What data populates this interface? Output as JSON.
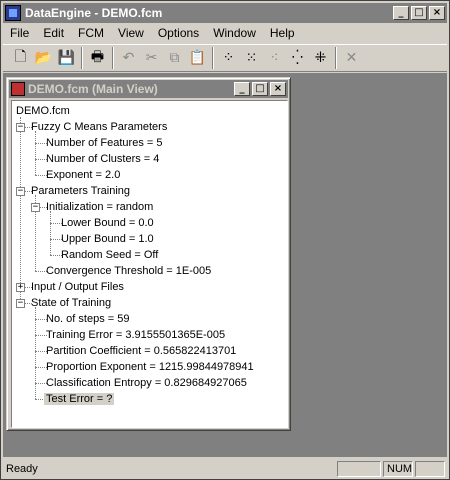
{
  "window": {
    "title": "DataEngine - DEMO.fcm"
  },
  "menu": [
    "File",
    "Edit",
    "FCM",
    "View",
    "Options",
    "Window",
    "Help"
  ],
  "toolbar": {
    "buttons": [
      {
        "name": "new-file-icon",
        "glyph": "🗋",
        "disabled": false
      },
      {
        "name": "open-folder-icon",
        "glyph": "📂",
        "disabled": false
      },
      {
        "name": "save-icon",
        "glyph": "💾",
        "disabled": false
      },
      {
        "name": "print-icon",
        "glyph": "🖶",
        "disabled": false
      },
      {
        "name": "undo-icon",
        "glyph": "↶",
        "disabled": true
      },
      {
        "name": "cut-icon",
        "glyph": "✂",
        "disabled": true
      },
      {
        "name": "copy-icon",
        "glyph": "⧉",
        "disabled": true
      },
      {
        "name": "paste-icon",
        "glyph": "📋",
        "disabled": true
      },
      {
        "name": "fcm-scatter-1-icon",
        "glyph": "⁘",
        "disabled": false
      },
      {
        "name": "fcm-scatter-2-icon",
        "glyph": "⁙",
        "disabled": false
      },
      {
        "name": "fcm-scatter-3-icon",
        "glyph": "⁖",
        "disabled": true
      },
      {
        "name": "fcm-scatter-4-icon",
        "glyph": "⁛",
        "disabled": false
      },
      {
        "name": "fcm-scatter-5-icon",
        "glyph": "⁜",
        "disabled": false
      },
      {
        "name": "delete-icon",
        "glyph": "✕",
        "disabled": true
      }
    ]
  },
  "child_window": {
    "title": "DEMO.fcm (Main View)"
  },
  "tree": [
    {
      "level": 0,
      "label": "DEMO.fcm",
      "expander": null
    },
    {
      "level": 1,
      "label": "Fuzzy C Means Parameters",
      "expander": "-"
    },
    {
      "level": 2,
      "label": "Number of Features = 5",
      "expander": null
    },
    {
      "level": 2,
      "label": "Number of Clusters = 4",
      "expander": null
    },
    {
      "level": 2,
      "label": "Exponent = 2.0",
      "expander": null
    },
    {
      "level": 1,
      "label": "Parameters Training",
      "expander": "-"
    },
    {
      "level": 2,
      "label": "Initialization = random",
      "expander": "-"
    },
    {
      "level": 3,
      "label": "Lower Bound = 0.0",
      "expander": null
    },
    {
      "level": 3,
      "label": "Upper Bound = 1.0",
      "expander": null
    },
    {
      "level": 3,
      "label": "Random Seed = Off",
      "expander": null
    },
    {
      "level": 2,
      "label": "Convergence Threshold = 1E-005",
      "expander": null
    },
    {
      "level": 1,
      "label": "Input / Output Files",
      "expander": "+"
    },
    {
      "level": 1,
      "label": "State of Training",
      "expander": "-"
    },
    {
      "level": 2,
      "label": "No. of steps = 59",
      "expander": null
    },
    {
      "level": 2,
      "label": "Training Error = 3.9155501365E-005",
      "expander": null
    },
    {
      "level": 2,
      "label": "Partition Coefficient = 0.565822413701",
      "expander": null
    },
    {
      "level": 2,
      "label": "Proportion Exponent = 1215.99844978941",
      "expander": null
    },
    {
      "level": 2,
      "label": "Classification Entropy = 0.829684927065",
      "expander": null
    },
    {
      "level": 2,
      "label": "Test Error = ?",
      "expander": null,
      "selected": true
    }
  ],
  "status": {
    "text": "Ready",
    "num": "NUM"
  }
}
